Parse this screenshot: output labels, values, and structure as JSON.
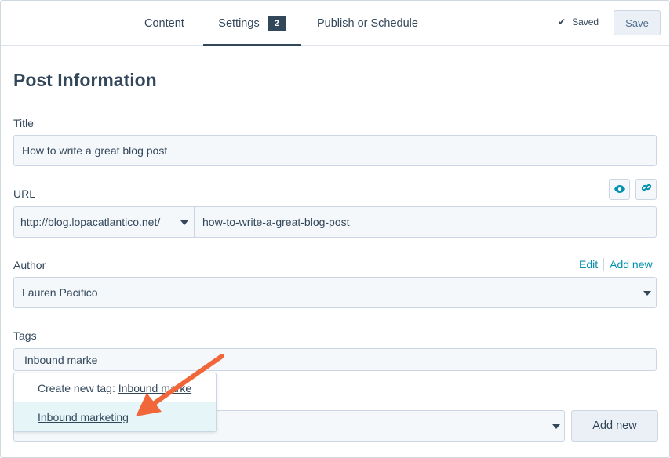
{
  "nav": {
    "tabs": [
      {
        "label": "Content"
      },
      {
        "label": "Settings",
        "badge": "2"
      },
      {
        "label": "Publish or Schedule"
      }
    ],
    "saved_label": "Saved",
    "save_label": "Save"
  },
  "form": {
    "heading": "Post Information",
    "title_label": "Title",
    "title_value": "How to write a great blog post",
    "url_label": "URL",
    "url_domain": "http://blog.lopacatlantico.net/",
    "url_slug": "how-to-write-a-great-blog-post",
    "author_label": "Author",
    "author_edit": "Edit",
    "author_add_new": "Add new",
    "author_value": "Lauren Pacifico",
    "tags_label": "Tags",
    "tags_value": "Inbound marke",
    "add_new_button": "Add new"
  },
  "tag_dropdown": {
    "create_prefix": "Create new tag: ",
    "create_value": "Inbound marke",
    "suggestion": "Inbound marketing"
  },
  "colors": {
    "accent": "#0091ae",
    "text": "#33475b",
    "arrow": "#f2673a"
  }
}
